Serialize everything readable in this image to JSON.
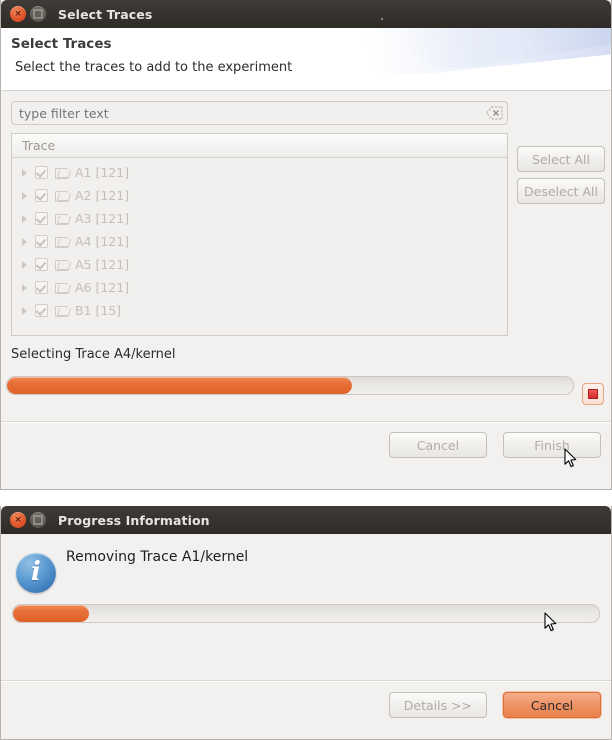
{
  "select_traces_dialog": {
    "window_title": "Select Traces",
    "wizard": {
      "title": "Select Traces",
      "description": "Select the traces to add to the experiment"
    },
    "filter": {
      "placeholder": "type filter text",
      "value": "",
      "clear_icon": "clear-filter-icon"
    },
    "tree": {
      "column_header": "Trace",
      "rows": [
        {
          "label": "A1 [121]",
          "checked": true,
          "expanded": false,
          "icon": "folder-icon"
        },
        {
          "label": "A2 [121]",
          "checked": true,
          "expanded": false,
          "icon": "folder-icon"
        },
        {
          "label": "A3 [121]",
          "checked": true,
          "expanded": false,
          "icon": "folder-icon"
        },
        {
          "label": "A4 [121]",
          "checked": true,
          "expanded": false,
          "icon": "folder-icon"
        },
        {
          "label": "A5 [121]",
          "checked": true,
          "expanded": false,
          "icon": "folder-icon"
        },
        {
          "label": "A6 [121]",
          "checked": true,
          "expanded": false,
          "icon": "folder-icon"
        },
        {
          "label": "B1 [15]",
          "checked": true,
          "expanded": false,
          "icon": "folder-icon"
        }
      ]
    },
    "side_buttons": {
      "select_all": "Select All",
      "deselect_all": "Deselect All"
    },
    "progress": {
      "task_label": "Selecting Trace A4/kernel",
      "percent": 61,
      "stop_icon": "stop-square-icon"
    },
    "footer_buttons": {
      "cancel": "Cancel",
      "finish": "Finish"
    }
  },
  "progress_information_dialog": {
    "window_title": "Progress Information",
    "icon": "info-icon",
    "message": "Removing Trace A1/kernel",
    "progress": {
      "percent": 13,
      "indeterminate": true
    },
    "footer_buttons": {
      "details": "Details >>",
      "cancel": "Cancel"
    }
  },
  "colors": {
    "titlebar": "#37342f",
    "titlebar_text": "#e8e5e1",
    "close_button": "#e2552a",
    "progress_orange": "#e8703a",
    "default_button_orange": "#ee9a6e",
    "dialog_background": "#f2f1f0",
    "disabled_text": "#b0aca7",
    "stop_red": "#d42b2b",
    "info_blue": "#3f7fbd"
  }
}
